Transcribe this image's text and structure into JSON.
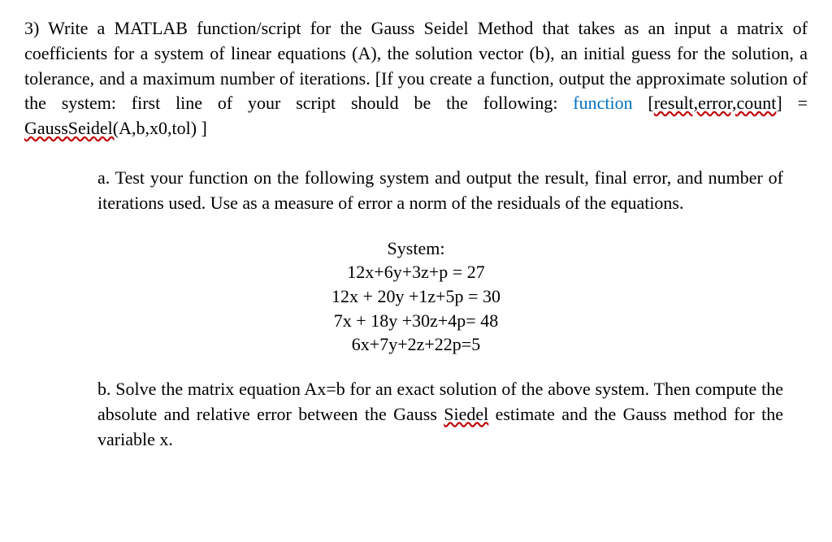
{
  "main": {
    "q_num": "3)",
    "text1": " Write a MATLAB function/script for the Gauss Seidel Method that takes as an input a matrix of coefficients for a system of linear equations (A), the solution vector (b), an initial guess for the solution, a tolerance, and a maximum number of iterations.  [If you create a function, output the approximate solution of the system: first line of your script should be the following:  ",
    "func_kw": "function",
    "func_sig1": " [",
    "func_sig2": "result,error,count",
    "func_sig3": "] = ",
    "func_call": "GaussSeidel(",
    "func_tail": "A,b,x0,tol) ]"
  },
  "part_a": {
    "label": "a.",
    "text": "  Test your function on the following system and output the result, final error, and number of iterations used. Use as a measure of error a norm of the residuals of the equations."
  },
  "system": {
    "title": "System:",
    "eq1": "12x+6y+3z+p = 27",
    "eq2": "12x + 20y +1z+5p = 30",
    "eq3": "7x + 18y +30z+4p= 48",
    "eq4": "6x+7y+2z+22p=5"
  },
  "part_b": {
    "label": "b.",
    "text1": "  Solve the matrix equation Ax=b for an exact solution of the above system. Then compute the absolute and relative error between the Gauss ",
    "siedel": "Siedel",
    "text2": " estimate and the Gauss method for the variable x."
  }
}
